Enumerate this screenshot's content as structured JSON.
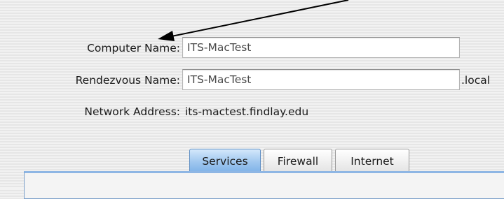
{
  "fields": {
    "computer_name": {
      "label": "Computer Name:",
      "value": "ITS-MacTest"
    },
    "rendezvous_name": {
      "label": "Rendezvous Name:",
      "value": "ITS-MacTest",
      "suffix": ".local"
    },
    "network_address": {
      "label": "Network Address:",
      "value": "its-mactest.findlay.edu"
    }
  },
  "tabs": [
    {
      "label": "Services",
      "active": true
    },
    {
      "label": "Firewall",
      "active": false
    },
    {
      "label": "Internet",
      "active": false
    }
  ],
  "annotation": {
    "icon": "arrow-icon",
    "color": "#000000"
  }
}
